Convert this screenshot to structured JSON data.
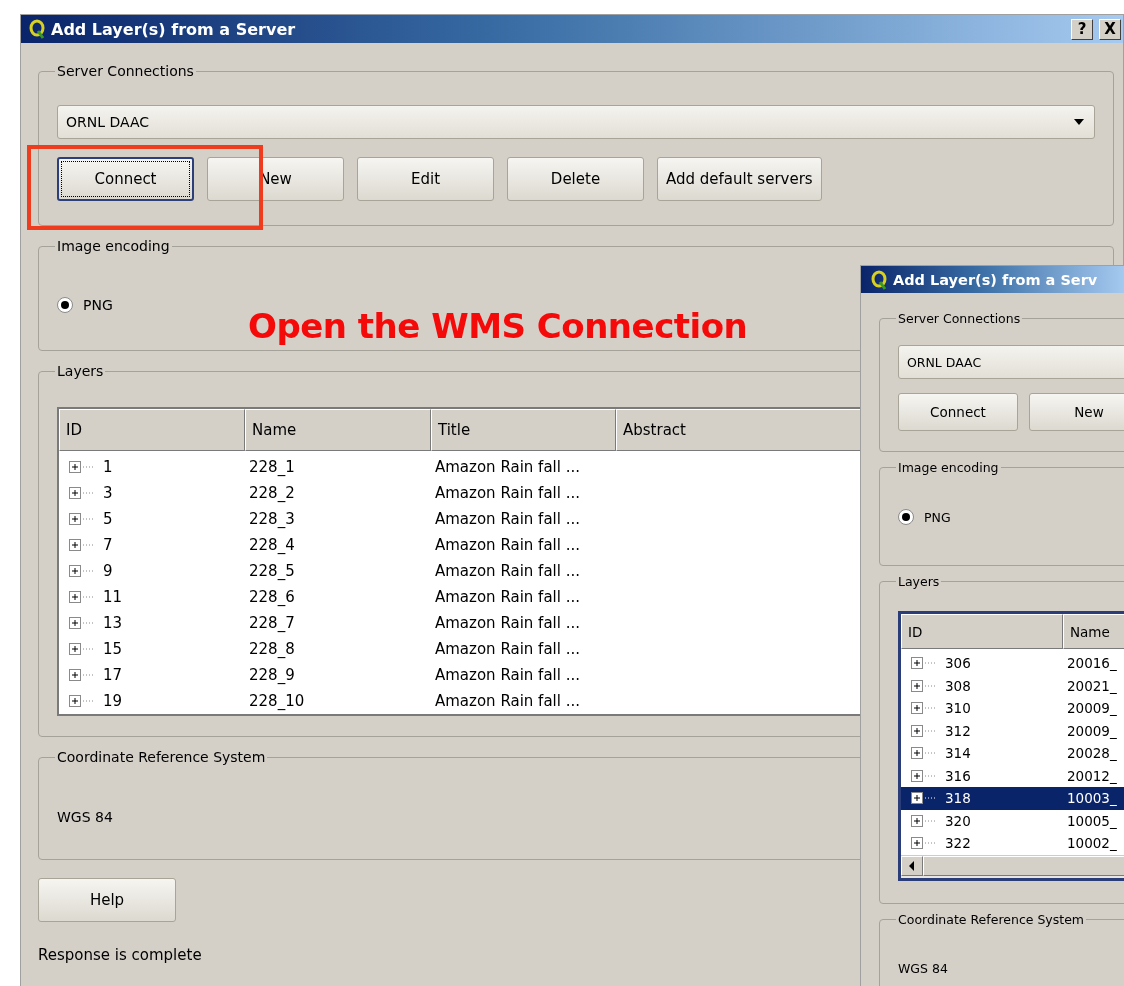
{
  "main_dialog": {
    "title": "Add Layer(s) from a Server",
    "title_buttons": [
      "?",
      "X"
    ],
    "server_connections": {
      "label": "Server Connections",
      "selected_server": "ORNL DAAC",
      "buttons": [
        {
          "label": "Connect",
          "focused": true
        },
        {
          "label": "New",
          "focused": false
        },
        {
          "label": "Edit",
          "focused": false
        },
        {
          "label": "Delete",
          "focused": false
        },
        {
          "label": "Add default servers",
          "focused": false
        }
      ]
    },
    "image_encoding": {
      "label": "Image encoding",
      "options": [
        {
          "label": "PNG",
          "selected": true
        }
      ]
    },
    "layers": {
      "label": "Layers",
      "columns": [
        "ID",
        "Name",
        "Title",
        "Abstract"
      ],
      "horizontal_scrollbar": false,
      "rows": [
        {
          "id": "1",
          "name": "228_1",
          "title": "Amazon Rain fall ...",
          "expanded": false,
          "selected": false
        },
        {
          "id": "3",
          "name": "228_2",
          "title": "Amazon Rain fall ...",
          "expanded": false,
          "selected": false
        },
        {
          "id": "5",
          "name": "228_3",
          "title": "Amazon Rain fall ...",
          "expanded": false,
          "selected": false
        },
        {
          "id": "7",
          "name": "228_4",
          "title": "Amazon Rain fall ...",
          "expanded": false,
          "selected": false
        },
        {
          "id": "9",
          "name": "228_5",
          "title": "Amazon Rain fall ...",
          "expanded": false,
          "selected": false
        },
        {
          "id": "11",
          "name": "228_6",
          "title": "Amazon Rain fall ...",
          "expanded": false,
          "selected": false
        },
        {
          "id": "13",
          "name": "228_7",
          "title": "Amazon Rain fall ...",
          "expanded": false,
          "selected": false
        },
        {
          "id": "15",
          "name": "228_8",
          "title": "Amazon Rain fall ...",
          "expanded": false,
          "selected": false
        },
        {
          "id": "17",
          "name": "228_9",
          "title": "Amazon Rain fall ...",
          "expanded": false,
          "selected": false
        },
        {
          "id": "19",
          "name": "228_10",
          "title": "Amazon Rain fall ...",
          "expanded": false,
          "selected": false
        }
      ]
    },
    "crs": {
      "label": "Coordinate Reference System",
      "value": "WGS 84"
    },
    "help_button": "Help",
    "status": "Response is complete"
  },
  "second_dialog": {
    "title": "Add Layer(s) from a Serv",
    "server_connections": {
      "label": "Server Connections",
      "selected_server": "ORNL DAAC",
      "buttons": [
        {
          "label": "Connect",
          "focused": false
        },
        {
          "label": "New",
          "focused": false
        }
      ]
    },
    "image_encoding": {
      "label": "Image encoding",
      "options": [
        {
          "label": "PNG",
          "selected": true
        }
      ]
    },
    "layers": {
      "label": "Layers",
      "columns": [
        "ID",
        "Name"
      ],
      "horizontal_scrollbar": true,
      "rows": [
        {
          "id": "306",
          "name": "20016_",
          "expanded": false,
          "selected": false
        },
        {
          "id": "308",
          "name": "20021_",
          "expanded": false,
          "selected": false
        },
        {
          "id": "310",
          "name": "20009_",
          "expanded": false,
          "selected": false
        },
        {
          "id": "312",
          "name": "20009_",
          "expanded": false,
          "selected": false
        },
        {
          "id": "314",
          "name": "20028_",
          "expanded": false,
          "selected": false
        },
        {
          "id": "316",
          "name": "20012_",
          "expanded": false,
          "selected": false
        },
        {
          "id": "318",
          "name": "10003_",
          "expanded": false,
          "selected": true
        },
        {
          "id": "320",
          "name": "10005_",
          "expanded": false,
          "selected": false
        },
        {
          "id": "322",
          "name": "10002_",
          "expanded": false,
          "selected": false
        }
      ]
    },
    "crs": {
      "label": "Coordinate Reference System",
      "value": "WGS 84"
    }
  },
  "annotation": {
    "text": "Open the WMS Connection"
  }
}
